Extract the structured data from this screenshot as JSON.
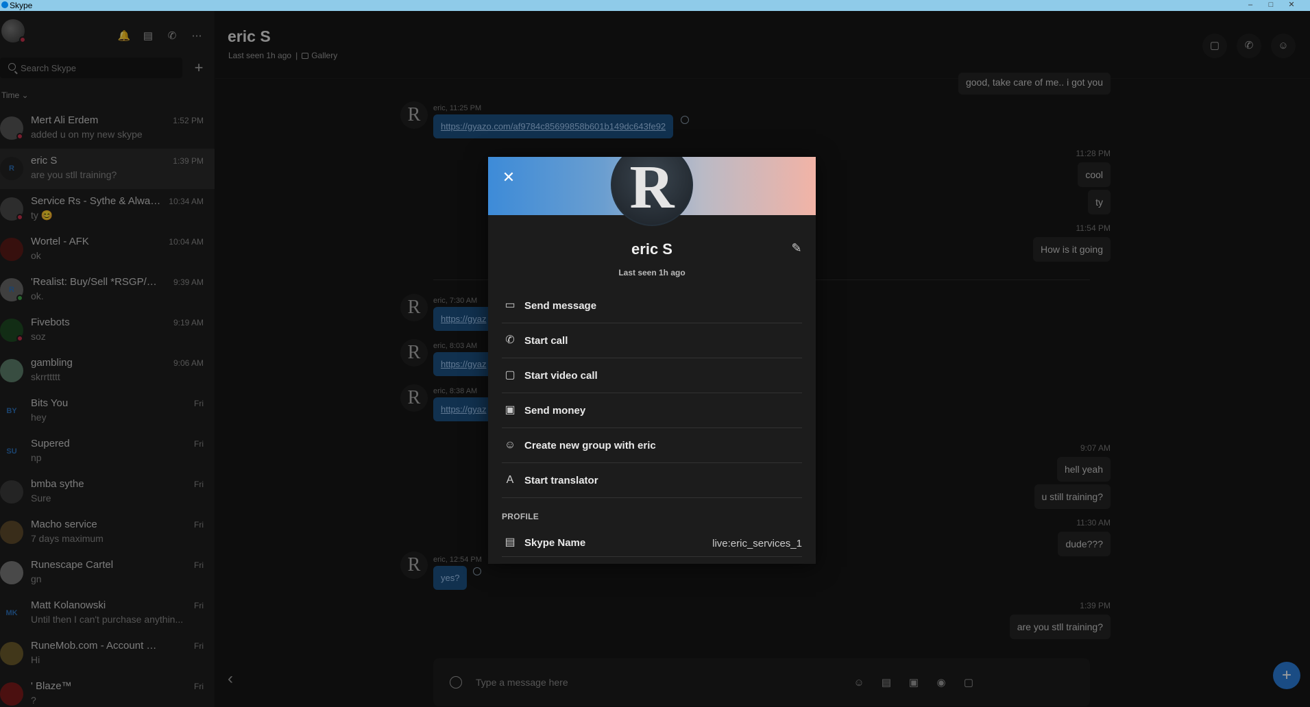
{
  "window": {
    "title": "Skype",
    "minimize": "–",
    "maximize": "□",
    "close": "✕"
  },
  "sidebar": {
    "search_placeholder": "Search Skype",
    "sort_label": "Time ⌄",
    "chats": [
      {
        "name": "Mert Ali Erdem",
        "message": "added u on my new skype",
        "time": "1:52 PM",
        "avatar": "",
        "status_color": "#c4314b",
        "avatar_color": "#555"
      },
      {
        "name": "eric S",
        "message": "are you stll training?",
        "time": "1:39 PM",
        "avatar": "R",
        "status_color": "",
        "avatar_color": "#222",
        "active": true
      },
      {
        "name": "Service Rs - Sythe & Alway...",
        "message": "ty 😊",
        "time": "10:34 AM",
        "avatar": "",
        "status_color": "#c4314b",
        "avatar_color": "#4a4a4a"
      },
      {
        "name": "Wortel - AFK",
        "message": "ok",
        "time": "10:04 AM",
        "avatar": "",
        "status_color": "",
        "avatar_color": "#5a1a18"
      },
      {
        "name": "'Realist: Buy/Sell *RSGP/CS:...",
        "message": "ok.",
        "time": "9:39 AM",
        "avatar": "R",
        "status_color": "#3ea34a",
        "avatar_color": "#666"
      },
      {
        "name": "Fivebots",
        "message": "soz",
        "time": "9:19 AM",
        "avatar": "",
        "status_color": "#c4314b",
        "avatar_color": "#1d4a22"
      },
      {
        "name": "gambling",
        "message": "skrrttttt",
        "time": "9:06 AM",
        "avatar": "",
        "status_color": "",
        "avatar_color": "#5b7d6a"
      },
      {
        "name": "Bits You",
        "message": "hey",
        "time": "Fri",
        "avatar": "BY",
        "status_color": "",
        "avatar_color": "#1e1e1e"
      },
      {
        "name": "Supered",
        "message": "np",
        "time": "Fri",
        "avatar": "SU",
        "status_color": "",
        "avatar_color": "#1e1e1e"
      },
      {
        "name": "bmba sythe",
        "message": "Sure",
        "time": "Fri",
        "avatar": "",
        "status_color": "",
        "avatar_color": "#3a3a3a"
      },
      {
        "name": "Macho service",
        "message": "7 days maximum",
        "time": "Fri",
        "avatar": "",
        "status_color": "",
        "avatar_color": "#5c4a2a"
      },
      {
        "name": "Runescape Cartel",
        "message": "gn",
        "time": "Fri",
        "avatar": "",
        "status_color": "",
        "avatar_color": "#777"
      },
      {
        "name": "Matt Kolanowski",
        "message": "Until then I can't purchase anythin...",
        "time": "Fri",
        "avatar": "MK",
        "status_color": "",
        "avatar_color": "#1e1e1e"
      },
      {
        "name": "RuneMob.com - Account Rentals...",
        "message": "Hi",
        "time": "Fri",
        "avatar": "",
        "status_color": "",
        "avatar_color": "#6a5a2a"
      },
      {
        "name": "' Blaze™",
        "message": "?",
        "time": "Fri",
        "avatar": "",
        "status_color": "",
        "avatar_color": "#7a1a1a"
      }
    ]
  },
  "chat": {
    "title": "eric S",
    "last_seen": "Last seen 1h ago",
    "gallery": "Gallery",
    "composer_placeholder": "Type a message here",
    "messages": {
      "top_out": "good, take care of me.. i got you",
      "meta1": "eric, 11:25 PM",
      "link1": "https://gyazo.com/af9784c85699858b601b149dc643fe92",
      "t1": "11:28 PM",
      "out1": "cool",
      "out2": "ty",
      "t2": "11:54 PM",
      "out3": "How is it going",
      "meta2": "eric, 7:30 AM",
      "link2": "https://gyaz",
      "meta3": "eric, 8:03 AM",
      "link3": "https://gyaz",
      "meta4": "eric, 8:38 AM",
      "link4": "https://gyaz",
      "t3": "9:07 AM",
      "out4": "hell yeah",
      "out5": "u still training?",
      "t4": "11:30 AM",
      "out6": "dude???",
      "meta5": "eric, 12:54 PM",
      "in5": "yes?",
      "t5": "1:39 PM",
      "out7": "are you stll training?"
    }
  },
  "profile": {
    "name": "eric S",
    "last_seen": "Last seen 1h ago",
    "avatar_letter": "R",
    "actions": [
      {
        "label": "Send message",
        "icon": "▭"
      },
      {
        "label": "Start call",
        "icon": "✆"
      },
      {
        "label": "Start video call",
        "icon": "▢"
      },
      {
        "label": "Send money",
        "icon": "▣"
      },
      {
        "label": "Create new group with eric",
        "icon": "☺"
      },
      {
        "label": "Start translator",
        "icon": "A"
      }
    ],
    "section_profile": "PROFILE",
    "skype_name_label": "Skype Name",
    "skype_name_value": "live:eric_services_1"
  },
  "colors": {
    "accent": "#2b7bd6",
    "bubble_in": "#1c4f80",
    "bubble_out": "#242424",
    "background": "#151515"
  }
}
